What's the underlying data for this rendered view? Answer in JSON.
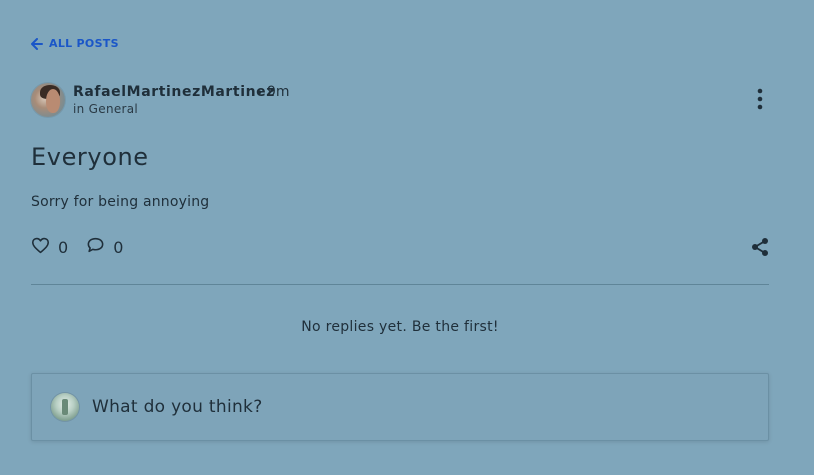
{
  "nav": {
    "back_label": "ALL POSTS",
    "back_icon": "arrow-left-icon"
  },
  "post": {
    "author": "RafaelMartinezMartinez",
    "separator": "•",
    "time": "9m",
    "category_prefix": "in",
    "category": "General",
    "title": "Everyone",
    "body": "Sorry for being annoying",
    "likes": "0",
    "comments": "0",
    "icons": {
      "more": "more-vertical-icon",
      "like": "heart-icon",
      "comment": "comment-icon",
      "share": "share-icon"
    }
  },
  "replies": {
    "empty_text": "No replies yet. Be the first!"
  },
  "reply_box": {
    "placeholder": "What do you think?"
  },
  "colors": {
    "background": "#7fa6bb",
    "accent": "#1a56c8",
    "text": "#1f2f3a"
  }
}
